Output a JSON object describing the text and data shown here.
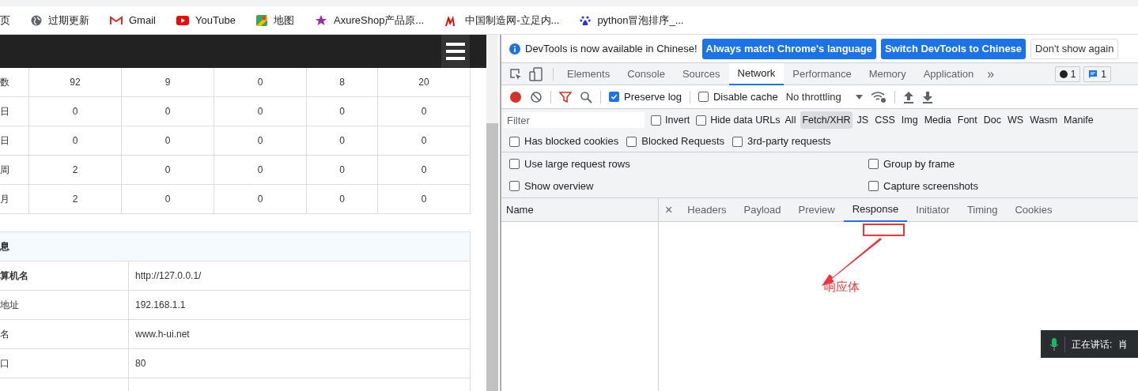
{
  "bookmarks": [
    {
      "label": "页"
    },
    {
      "label": "过期更新"
    },
    {
      "label": "Gmail"
    },
    {
      "label": "YouTube"
    },
    {
      "label": "地图"
    },
    {
      "label": "AxureShop产品原..."
    },
    {
      "label": "中国制造网-立足内..."
    },
    {
      "label": "python冒泡排序_..."
    }
  ],
  "stats_table": {
    "rows": [
      [
        "数",
        "92",
        "9",
        "0",
        "8",
        "20"
      ],
      [
        "日",
        "0",
        "0",
        "0",
        "0",
        "0"
      ],
      [
        "日",
        "0",
        "0",
        "0",
        "0",
        "0"
      ],
      [
        "周",
        "2",
        "0",
        "0",
        "0",
        "0"
      ],
      [
        "月",
        "2",
        "0",
        "0",
        "0",
        "0"
      ]
    ]
  },
  "info_table": {
    "title": "息",
    "rows": [
      {
        "label": "算机名",
        "value": "http://127.0.0.1/",
        "bold": true
      },
      {
        "label": "地址",
        "value": "192.168.1.1",
        "bold": false
      },
      {
        "label": "名",
        "value": "www.h-ui.net",
        "bold": false
      },
      {
        "label": "口",
        "value": "80",
        "bold": false
      }
    ]
  },
  "devtools": {
    "infobar": {
      "message": "DevTools is now available in Chinese!",
      "buttons": [
        {
          "label": "Always match Chrome's language",
          "primary": true
        },
        {
          "label": "Switch DevTools to Chinese",
          "primary": true
        },
        {
          "label": "Don't show again",
          "primary": false
        }
      ]
    },
    "tabs": [
      {
        "label": "Elements",
        "selected": false
      },
      {
        "label": "Console",
        "selected": false
      },
      {
        "label": "Sources",
        "selected": false
      },
      {
        "label": "Network",
        "selected": true
      },
      {
        "label": "Performance",
        "selected": false
      },
      {
        "label": "Memory",
        "selected": false
      },
      {
        "label": "Application",
        "selected": false
      }
    ],
    "more": "»",
    "badges": [
      {
        "kind": "error",
        "count": "1"
      },
      {
        "kind": "message",
        "count": "1"
      }
    ],
    "toolbar": {
      "preserve_log": {
        "label": "Preserve log",
        "checked": true
      },
      "disable_cache": {
        "label": "Disable cache",
        "checked": false
      },
      "throttling": "No throttling"
    },
    "filter": {
      "placeholder": "Filter"
    },
    "filter_checks": [
      {
        "label": "Invert",
        "checked": false
      },
      {
        "label": "Hide data URLs",
        "checked": false
      }
    ],
    "types": [
      {
        "label": "All",
        "selected": false
      },
      {
        "label": "Fetch/XHR",
        "selected": true
      },
      {
        "label": "JS",
        "selected": false
      },
      {
        "label": "CSS",
        "selected": false
      },
      {
        "label": "Img",
        "selected": false
      },
      {
        "label": "Media",
        "selected": false
      },
      {
        "label": "Font",
        "selected": false
      },
      {
        "label": "Doc",
        "selected": false
      },
      {
        "label": "WS",
        "selected": false
      },
      {
        "label": "Wasm",
        "selected": false
      },
      {
        "label": "Manife",
        "selected": false
      }
    ],
    "blocked_checks": [
      {
        "label": "Has blocked cookies",
        "checked": false
      },
      {
        "label": "Blocked Requests",
        "checked": false
      },
      {
        "label": "3rd-party requests",
        "checked": false
      }
    ],
    "settings": [
      {
        "label": "Use large request rows",
        "checked": false
      },
      {
        "label": "Group by frame",
        "checked": false
      },
      {
        "label": "Show overview",
        "checked": false
      },
      {
        "label": "Capture screenshots",
        "checked": false
      }
    ],
    "name_column": "Name",
    "close": "×",
    "detail_tabs": [
      {
        "label": "Headers",
        "selected": false
      },
      {
        "label": "Payload",
        "selected": false
      },
      {
        "label": "Preview",
        "selected": false
      },
      {
        "label": "Response",
        "selected": true
      },
      {
        "label": "Initiator",
        "selected": false
      },
      {
        "label": "Timing",
        "selected": false
      },
      {
        "label": "Cookies",
        "selected": false
      }
    ]
  },
  "annotation": {
    "label": "响应体"
  },
  "voice_toast": {
    "label": "正在讲话:",
    "speaker": "肖"
  }
}
